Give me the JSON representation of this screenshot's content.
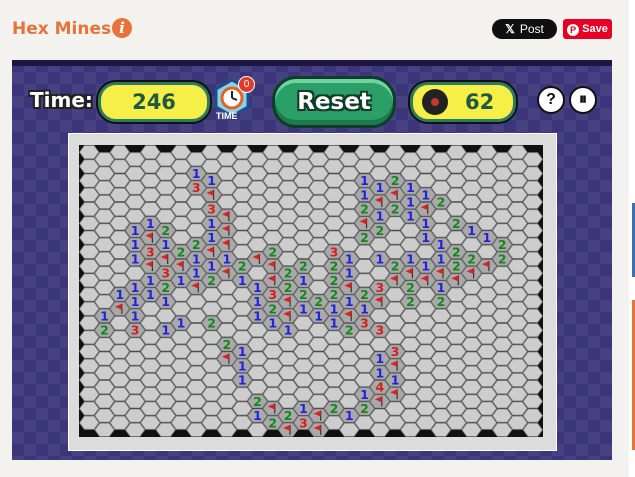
{
  "header": {
    "title": "Hex Mines",
    "info_icon": "info-icon"
  },
  "share": {
    "x_post_label": "Post",
    "pin_save_label": "Save"
  },
  "toolbar": {
    "time_label": "Time:",
    "time_value": "246",
    "hint_badge": "0",
    "hint_label": "TIME",
    "reset_label": "Reset",
    "mines_value": "62",
    "help_icon": "question-icon",
    "pause_icon": "pause-icon"
  },
  "colors": {
    "num1": "#2222dd",
    "num2": "#11881b",
    "num3": "#d42020",
    "flag": "#e02020",
    "open": "#a9a9a9",
    "closed": "#cdcdcd"
  },
  "board": {
    "cols": 30,
    "rows": 20,
    "cells": [
      [
        7,
        1,
        "1"
      ],
      [
        7,
        2,
        "3"
      ],
      [
        8,
        2,
        "1"
      ],
      [
        8,
        3,
        "F"
      ],
      [
        8,
        4,
        "3"
      ],
      [
        9,
        4,
        "F"
      ],
      [
        8,
        5,
        "1"
      ],
      [
        9,
        5,
        "F"
      ],
      [
        7,
        6,
        "2"
      ],
      [
        8,
        6,
        "1"
      ],
      [
        9,
        6,
        "F"
      ],
      [
        3,
        5,
        "1"
      ],
      [
        4,
        5,
        "1"
      ],
      [
        5,
        5,
        "2"
      ],
      [
        3,
        6,
        "1"
      ],
      [
        4,
        6,
        "F"
      ],
      [
        5,
        6,
        "1"
      ],
      [
        3,
        7,
        "1"
      ],
      [
        4,
        7,
        "3"
      ],
      [
        5,
        7,
        "F"
      ],
      [
        6,
        7,
        "2"
      ],
      [
        7,
        7,
        "1"
      ],
      [
        8,
        7,
        "F"
      ],
      [
        9,
        7,
        "1"
      ],
      [
        4,
        8,
        "F"
      ],
      [
        5,
        8,
        "3"
      ],
      [
        6,
        8,
        "F"
      ],
      [
        7,
        8,
        "1"
      ],
      [
        8,
        8,
        "1"
      ],
      [
        9,
        8,
        "F"
      ],
      [
        10,
        8,
        "2"
      ],
      [
        3,
        9,
        "1"
      ],
      [
        4,
        9,
        "1"
      ],
      [
        5,
        9,
        "2"
      ],
      [
        6,
        9,
        "1"
      ],
      [
        7,
        9,
        "F"
      ],
      [
        8,
        9,
        "2"
      ],
      [
        2,
        10,
        "1"
      ],
      [
        3,
        10,
        "1"
      ],
      [
        4,
        10,
        "1"
      ],
      [
        5,
        10,
        "1"
      ],
      [
        1,
        11,
        "1"
      ],
      [
        2,
        11,
        "F"
      ],
      [
        3,
        11,
        "1"
      ],
      [
        1,
        12,
        "2"
      ],
      [
        3,
        12,
        "3"
      ],
      [
        5,
        12,
        "1"
      ],
      [
        6,
        12,
        "1"
      ],
      [
        8,
        12,
        "2"
      ],
      [
        9,
        13,
        "2"
      ],
      [
        9,
        14,
        "F"
      ],
      [
        10,
        14,
        "1"
      ],
      [
        10,
        15,
        "1"
      ],
      [
        10,
        16,
        "1"
      ],
      [
        11,
        7,
        "F"
      ],
      [
        12,
        7,
        "2"
      ],
      [
        12,
        8,
        "F"
      ],
      [
        13,
        8,
        "2"
      ],
      [
        14,
        8,
        "2"
      ],
      [
        10,
        9,
        "1"
      ],
      [
        11,
        9,
        "1"
      ],
      [
        12,
        9,
        "F"
      ],
      [
        13,
        9,
        "2"
      ],
      [
        14,
        9,
        "1"
      ],
      [
        11,
        10,
        "1"
      ],
      [
        12,
        10,
        "3"
      ],
      [
        13,
        10,
        "F"
      ],
      [
        14,
        10,
        "2"
      ],
      [
        15,
        10,
        "2"
      ],
      [
        11,
        11,
        "1"
      ],
      [
        12,
        11,
        "2"
      ],
      [
        13,
        11,
        "F"
      ],
      [
        14,
        11,
        "1"
      ],
      [
        15,
        11,
        "1"
      ],
      [
        12,
        12,
        "1"
      ],
      [
        13,
        12,
        "1"
      ],
      [
        16,
        7,
        "3"
      ],
      [
        17,
        7,
        "1"
      ],
      [
        16,
        8,
        "2"
      ],
      [
        17,
        8,
        "1"
      ],
      [
        16,
        9,
        "2"
      ],
      [
        17,
        9,
        "F"
      ],
      [
        16,
        10,
        "2"
      ],
      [
        17,
        10,
        "1"
      ],
      [
        18,
        10,
        "2"
      ],
      [
        16,
        11,
        "1"
      ],
      [
        17,
        11,
        "F"
      ],
      [
        18,
        11,
        "1"
      ],
      [
        16,
        12,
        "1"
      ],
      [
        17,
        12,
        "2"
      ],
      [
        18,
        12,
        "3"
      ],
      [
        18,
        2,
        "1"
      ],
      [
        19,
        2,
        "1"
      ],
      [
        20,
        2,
        "2"
      ],
      [
        21,
        2,
        "1"
      ],
      [
        18,
        3,
        "1"
      ],
      [
        19,
        3,
        "F"
      ],
      [
        20,
        3,
        "F"
      ],
      [
        21,
        3,
        "1"
      ],
      [
        22,
        3,
        "1"
      ],
      [
        23,
        3,
        "2"
      ],
      [
        18,
        4,
        "2"
      ],
      [
        19,
        4,
        "1"
      ],
      [
        20,
        4,
        "2"
      ],
      [
        21,
        4,
        "1"
      ],
      [
        22,
        4,
        "F"
      ],
      [
        18,
        5,
        "F"
      ],
      [
        19,
        5,
        "2"
      ],
      [
        22,
        5,
        "1"
      ],
      [
        24,
        5,
        "2"
      ],
      [
        25,
        5,
        "1"
      ],
      [
        18,
        6,
        "2"
      ],
      [
        22,
        6,
        "1"
      ],
      [
        23,
        6,
        "1"
      ],
      [
        26,
        6,
        "1"
      ],
      [
        27,
        6,
        "2"
      ],
      [
        19,
        7,
        "1"
      ],
      [
        21,
        7,
        "1"
      ],
      [
        23,
        7,
        "1"
      ],
      [
        24,
        7,
        "2"
      ],
      [
        25,
        7,
        "2"
      ],
      [
        27,
        7,
        "2"
      ],
      [
        20,
        8,
        "2"
      ],
      [
        21,
        8,
        "F"
      ],
      [
        22,
        8,
        "1"
      ],
      [
        23,
        8,
        "F"
      ],
      [
        24,
        8,
        "2"
      ],
      [
        25,
        8,
        "F"
      ],
      [
        26,
        8,
        "F"
      ],
      [
        19,
        9,
        "3"
      ],
      [
        20,
        9,
        "F"
      ],
      [
        21,
        9,
        "2"
      ],
      [
        22,
        9,
        "F"
      ],
      [
        23,
        9,
        "1"
      ],
      [
        24,
        9,
        "F"
      ],
      [
        19,
        10,
        "F"
      ],
      [
        21,
        10,
        "2"
      ],
      [
        23,
        10,
        "2"
      ],
      [
        19,
        12,
        "3"
      ],
      [
        19,
        14,
        "1"
      ],
      [
        20,
        14,
        "3"
      ],
      [
        19,
        15,
        "1"
      ],
      [
        20,
        15,
        "F"
      ],
      [
        19,
        16,
        "4"
      ],
      [
        20,
        16,
        "1"
      ],
      [
        18,
        17,
        "1"
      ],
      [
        19,
        17,
        "F"
      ],
      [
        20,
        17,
        "F"
      ],
      [
        18,
        18,
        "2"
      ],
      [
        17,
        18,
        "1"
      ],
      [
        16,
        18,
        "2"
      ],
      [
        15,
        18,
        "F"
      ],
      [
        14,
        18,
        "1"
      ],
      [
        13,
        18,
        "2"
      ],
      [
        11,
        17,
        "2"
      ],
      [
        12,
        18,
        "F"
      ],
      [
        11,
        18,
        "1"
      ],
      [
        12,
        19,
        "2"
      ],
      [
        13,
        19,
        "F"
      ],
      [
        14,
        19,
        "3"
      ],
      [
        15,
        19,
        "F"
      ]
    ]
  }
}
